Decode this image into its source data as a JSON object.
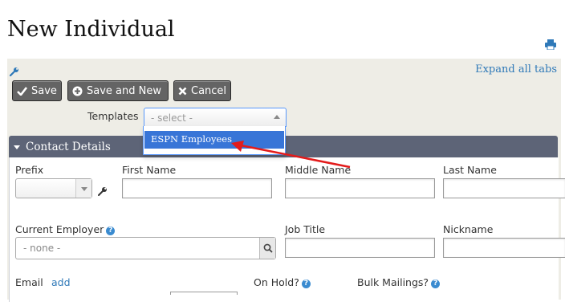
{
  "page": {
    "title": "New Individual"
  },
  "toolbar": {
    "expand_all": "Expand all tabs",
    "buttons": {
      "save": "Save",
      "save_new": "Save and New",
      "cancel": "Cancel"
    }
  },
  "templates": {
    "label": "Templates",
    "placeholder": "- select -",
    "options": [
      "ESPN Employees"
    ],
    "highlighted": "ESPN Employees"
  },
  "section": {
    "title": "Contact Details"
  },
  "fields": {
    "prefix": "Prefix",
    "first_name": "First Name",
    "middle_name": "Middle Name",
    "last_name": "Last Name",
    "current_employer": "Current Employer",
    "employer_placeholder": "- none -",
    "job_title": "Job Title",
    "nickname": "Nickname",
    "email": "Email",
    "email_add": "add",
    "on_hold": "On Hold?",
    "bulk_mailings": "Bulk Mailings?"
  },
  "colors": {
    "accent": "#2f79b8",
    "highlight": "#3875d7",
    "section_bar": "#5d6477",
    "annotation_arrow": "#e31b1b"
  },
  "help_icon_glyph": "?"
}
